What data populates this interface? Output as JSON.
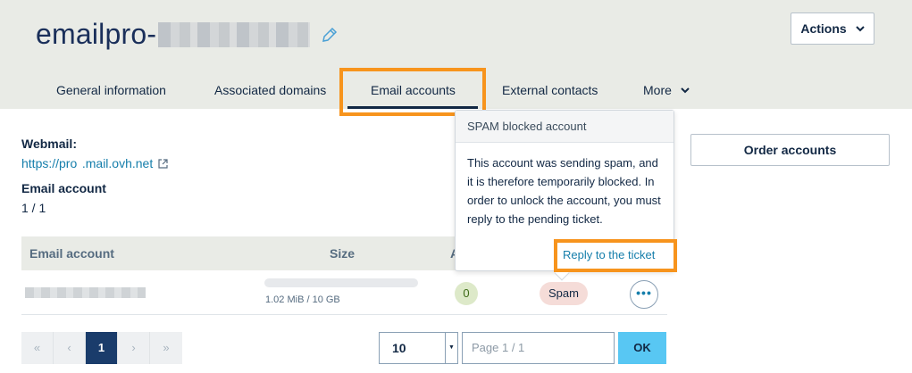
{
  "header": {
    "title": "emailpro-",
    "actions_label": "Actions",
    "colors": {
      "background": "#e9ebe6",
      "title": "#1a2f5a",
      "highlight": "#f7941d"
    }
  },
  "tabs": [
    {
      "label": "General information"
    },
    {
      "label": "Associated domains"
    },
    {
      "label": "Email accounts",
      "active": true
    },
    {
      "label": "External contacts"
    },
    {
      "label": "More"
    }
  ],
  "info": {
    "webmail_label": "Webmail:",
    "webmail_link": "https://pro  .mail.ovh.net",
    "email_account_label": "Email account",
    "email_account_value": "1 / 1"
  },
  "table": {
    "headers": [
      "Email account",
      "Size",
      "A"
    ],
    "rows": [
      {
        "size_text": "1.02 MiB / 10 GB",
        "size_fraction": 0.0001,
        "count": "0",
        "status": "Spam"
      }
    ]
  },
  "popover": {
    "title": "SPAM blocked account",
    "body": "This account was sending spam, and it is therefore temporarily blocked. In order to unlock the account, you must reply to the pending ticket.",
    "link": "Reply to the ticket"
  },
  "order_button": "Order accounts",
  "pagination": {
    "first": "«",
    "prev": "‹",
    "current": "1",
    "next": "›",
    "last": "»",
    "page_size": "10",
    "page_placeholder": "Page 1 / 1",
    "ok": "OK"
  }
}
